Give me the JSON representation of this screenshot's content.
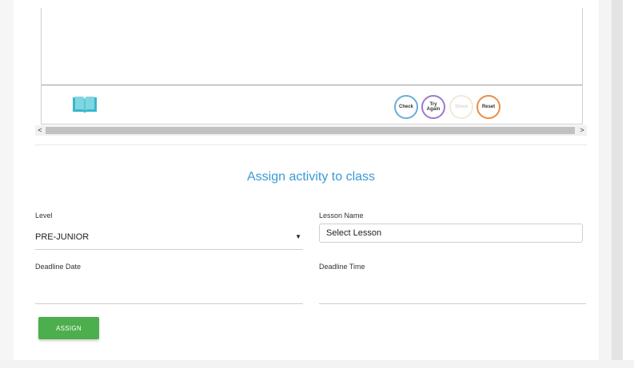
{
  "activity": {
    "buttons": {
      "check": "Check",
      "try_again_line1": "Try",
      "try_again_line2": "Again",
      "show": "Show",
      "reset": "Reset"
    },
    "scroll": {
      "left_arrow": "<",
      "right_arrow": ">"
    },
    "book_icon": "open-book-icon"
  },
  "form": {
    "title": "Assign activity to class",
    "level": {
      "label": "Level",
      "value": "PRE-JUNIOR",
      "caret": "▼"
    },
    "lesson": {
      "label": "Lesson Name",
      "placeholder": "Select Lesson"
    },
    "deadline_date": {
      "label": "Deadline Date",
      "value": ""
    },
    "deadline_time": {
      "label": "Deadline Time",
      "value": ""
    },
    "assign_button": "ASSIGN"
  },
  "colors": {
    "title": "#3a9ad4",
    "assign_button": "#4cae4c",
    "check_ring": "#6aaed6",
    "try_again_ring": "#9b7ad0",
    "show_ring": "#f2ead8",
    "reset_ring": "#e98d45",
    "book_icon": "#3ab7c8"
  }
}
